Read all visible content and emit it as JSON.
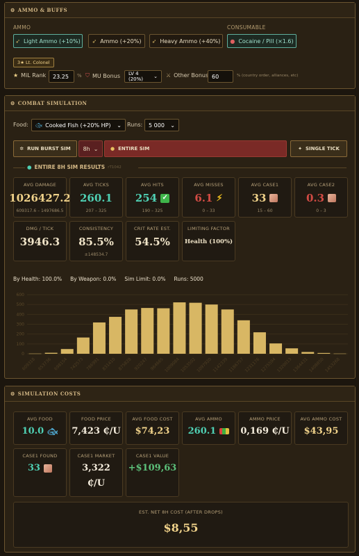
{
  "ammo_panel": {
    "title": "AMMO & BUFFS",
    "ammo_label": "AMMO",
    "consumable_label": "CONSUMABLE",
    "ammo_options": [
      {
        "label": "Light Ammo (+10%)",
        "selected": true
      },
      {
        "label": "Ammo (+20%)",
        "selected": false
      },
      {
        "label": "Heavy Ammo (+40%)",
        "selected": false
      }
    ],
    "consumable_option": {
      "label": "Cocaine / Pill (×1.6)",
      "selected": true
    },
    "rank_badge": "3★ Lt. Colonel",
    "mil_rank_label": "MiL Rank",
    "mil_rank_value": "23.25",
    "pct": "%",
    "mu_bonus_label": "MU Bonus",
    "mu_bonus_value": "LV 4 (20%)",
    "other_bonus_label": "Other Bonus",
    "other_bonus_value": "60",
    "other_bonus_note": "% (country order, alliances, etc)"
  },
  "combat_panel": {
    "title": "COMBAT SIMULATION",
    "food_label": "Food:",
    "food_value": "Cooked Fish (+20% HP)",
    "runs_label": "Runs:",
    "runs_value": "5 000",
    "run_burst_label": "RUN BURST SIM",
    "duration_value": "8h",
    "entire_sim_label": "ENTIRE SIM",
    "single_tick_label": "SINGLE TICK",
    "results_title": "ENTIRE 8H SIM RESULTS",
    "results_code": "rT1042",
    "stats": [
      {
        "title": "AVG DAMAGE",
        "value": "1026427.2",
        "sub": "609317.6 – 1497686.5",
        "color": "gold",
        "icon": ""
      },
      {
        "title": "AVG TICKS",
        "value": "260.1",
        "sub": "207 – 325",
        "color": "teal",
        "icon": ""
      },
      {
        "title": "AVG HITS",
        "value": "254",
        "sub": "190 – 325",
        "color": "teal",
        "icon": "check-icon"
      },
      {
        "title": "AVG MISSES",
        "value": "6.1",
        "sub": "0 – 33",
        "color": "red",
        "icon": "lightning-icon"
      },
      {
        "title": "AVG CASE1",
        "value": "33",
        "sub": "15 – 60",
        "color": "gold",
        "icon": "case-icon"
      },
      {
        "title": "AVG CASE2",
        "value": "0.3",
        "sub": "0 – 3",
        "color": "red",
        "icon": "case-icon"
      },
      {
        "title": "DMG / TICK",
        "value": "3946.3",
        "sub": "",
        "color": "wheat",
        "icon": ""
      },
      {
        "title": "CONSISTENCY",
        "value": "85.5%",
        "sub": "±148534.7",
        "color": "wheat",
        "icon": ""
      },
      {
        "title": "CRIT RATE EST.",
        "value": "54.5%",
        "sub": "",
        "color": "wheat",
        "icon": ""
      },
      {
        "title": "LIMITING FACTOR",
        "value": "Health (100%)",
        "sub": "",
        "color": "wheat",
        "icon": ""
      }
    ],
    "summary": [
      {
        "label": "By Health:",
        "value": "100.0%"
      },
      {
        "label": "By Weapon:",
        "value": "0.0%"
      },
      {
        "label": "Sim Limit:",
        "value": "0.0%"
      },
      {
        "label": "Runs:",
        "value": "5000"
      }
    ]
  },
  "chart_data": {
    "type": "bar",
    "ylim": [
      0,
      600
    ],
    "yticks": [
      "600",
      "500",
      "400",
      "300",
      "200",
      "100",
      "0"
    ],
    "categories": [
      "609318",
      "653736",
      "698154",
      "742573",
      "786991",
      "831410",
      "875828",
      "920247",
      "964665",
      "1009084",
      "1053502",
      "1097920",
      "1142339",
      "1186757",
      "1231176",
      "1275594",
      "1320013",
      "1364431",
      "1408850",
      "1453268"
    ],
    "values": [
      2,
      10,
      48,
      165,
      318,
      375,
      450,
      465,
      462,
      522,
      518,
      500,
      450,
      340,
      218,
      105,
      55,
      18,
      8,
      2
    ]
  },
  "costs_panel": {
    "title": "SIMULATION COSTS",
    "cards": [
      {
        "title": "AVG FOOD",
        "value": "10.0",
        "color": "teal",
        "icon": "fish-icon"
      },
      {
        "title": "FOOD PRICE",
        "value": "7,423 ₵/U",
        "color": "wht",
        "icon": ""
      },
      {
        "title": "AVG FOOD COST",
        "value": "$74,23",
        "color": "gold",
        "icon": ""
      },
      {
        "title": "AVG AMMO",
        "value": "260.1",
        "color": "teal",
        "icon": "ammo-icon"
      },
      {
        "title": "AMMO PRICE",
        "value": "0,169 ₵/U",
        "color": "wht",
        "icon": ""
      },
      {
        "title": "AVG AMMO COST",
        "value": "$43,95",
        "color": "gold",
        "icon": ""
      },
      {
        "title": "CASE1 FOUND",
        "value": "33",
        "color": "teal",
        "icon": "case-icon"
      },
      {
        "title": "CASE1 MARKET",
        "value": "3,322",
        "value2": "₵/U",
        "color": "wht",
        "icon": ""
      },
      {
        "title": "CASE1 VALUE",
        "value": "+$109,63",
        "color": "grn",
        "icon": ""
      }
    ],
    "net_label": "EST. NET 8H COST (AFTER DROPS)",
    "net_value": "$8,55"
  },
  "colors": {
    "gold": "#f0d28a",
    "teal": "#4fd0b4",
    "red": "#d24b44",
    "accent_red": "#7a2a26",
    "border": "#6b5530"
  }
}
